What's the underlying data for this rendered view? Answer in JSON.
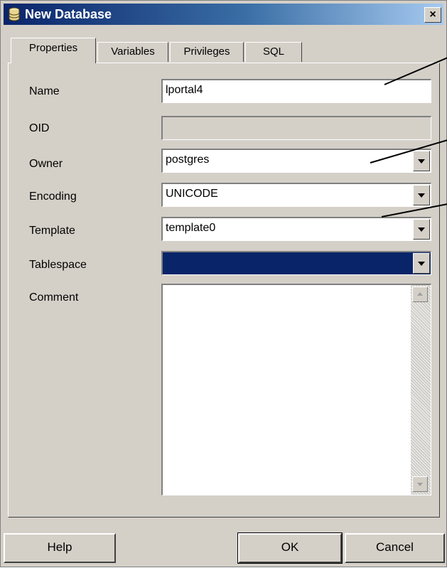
{
  "window": {
    "title": "New Database",
    "close_glyph": "×",
    "icon": "database-icon"
  },
  "tabs": [
    {
      "label": "Properties",
      "active": true
    },
    {
      "label": "Variables",
      "active": false
    },
    {
      "label": "Privileges",
      "active": false
    },
    {
      "label": "SQL",
      "active": false
    }
  ],
  "form": {
    "name": {
      "label": "Name",
      "value": "lportal4"
    },
    "oid": {
      "label": "OID",
      "value": ""
    },
    "owner": {
      "label": "Owner",
      "value": "postgres"
    },
    "encoding": {
      "label": "Encoding",
      "value": "UNICODE"
    },
    "template": {
      "label": "Template",
      "value": "template0"
    },
    "tablespace": {
      "label": "Tablespace",
      "value": ""
    },
    "comment": {
      "label": "Comment",
      "value": ""
    }
  },
  "buttons": {
    "help": "Help",
    "ok": "OK",
    "cancel": "Cancel"
  },
  "colors": {
    "title_bar": "#0a246a",
    "dialog_face": "#d4d0c8",
    "selection": "#0a246a"
  }
}
